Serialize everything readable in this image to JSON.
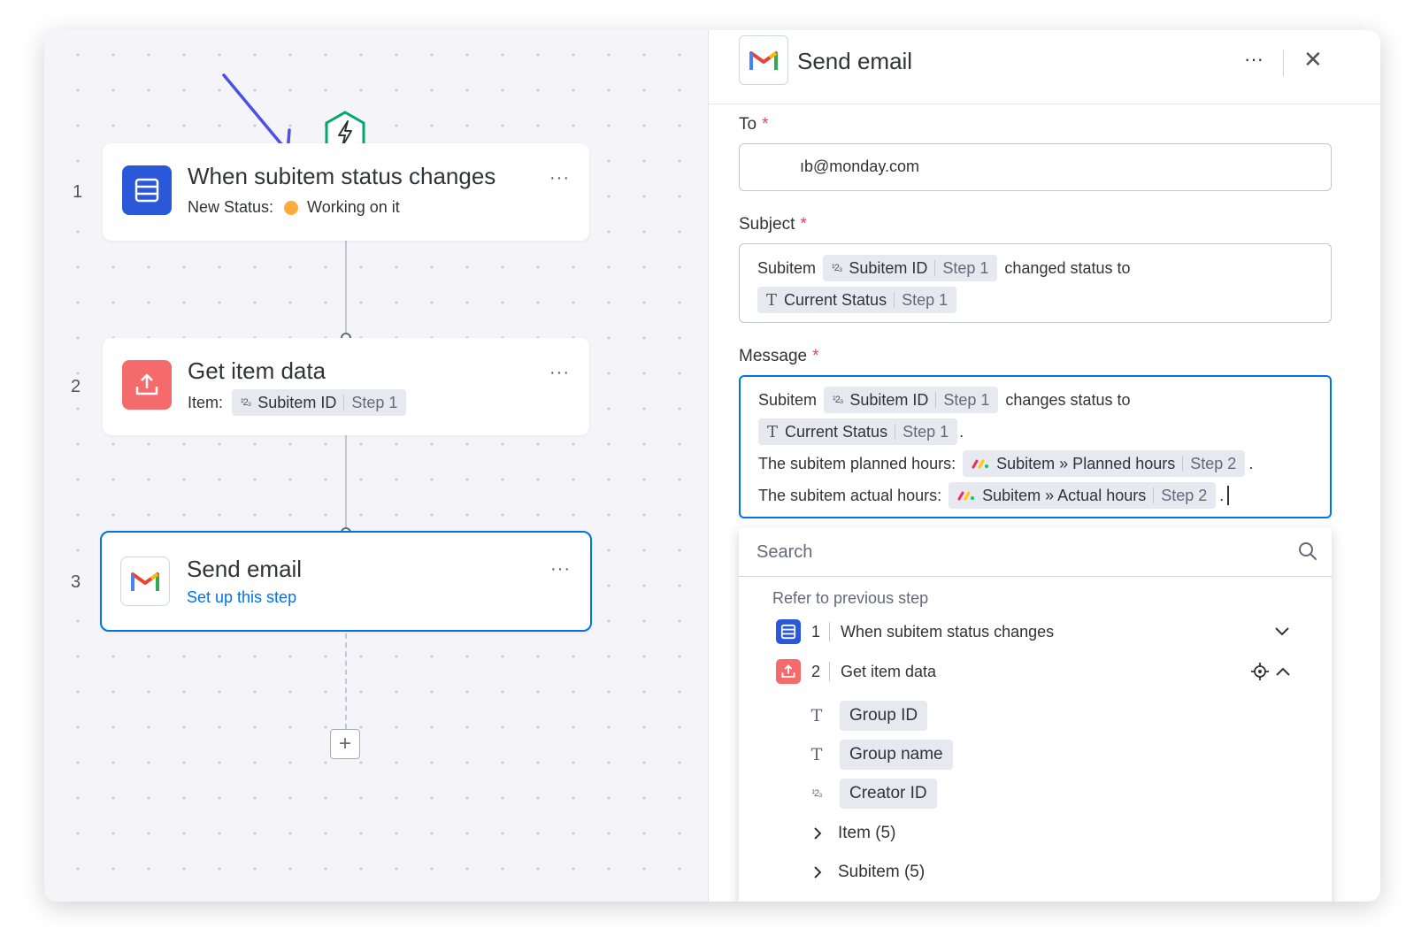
{
  "flow": {
    "steps": [
      {
        "number": "1",
        "title": "When subitem status changes",
        "sub_label": "New Status:",
        "status_value": "Working on it"
      },
      {
        "number": "2",
        "title": "Get item data",
        "sub_label": "Item:",
        "chip_label": "Subitem ID",
        "chip_step": "Step 1"
      },
      {
        "number": "3",
        "title": "Send email",
        "link": "Set up this step"
      }
    ],
    "menu_glyph": "···",
    "add_glyph": "+"
  },
  "panel": {
    "title": "Send email",
    "more_glyph": "···",
    "close_glyph": "✕",
    "to": {
      "label": "To",
      "required": "*",
      "value": "ıb@monday.com"
    },
    "subject": {
      "label": "Subject",
      "required": "*",
      "prefix": "Subitem",
      "chip1_label": "Subitem ID",
      "chip1_step": "Step 1",
      "mid": "changed status to",
      "chip2_label": "Current Status",
      "chip2_step": "Step 1"
    },
    "message": {
      "label": "Message",
      "required": "*",
      "line1_prefix": "Subitem",
      "line1_chip_label": "Subitem ID",
      "line1_chip_step": "Step 1",
      "line1_suffix": "changes status to",
      "line2_chip_label": "Current Status",
      "line2_chip_step": "Step 1",
      "line2_suffix": ".",
      "line3_prefix": "The subitem planned hours:",
      "line3_chip_label": "Subitem » Planned hours",
      "line3_chip_step": "Step 2",
      "line3_suffix": ".",
      "line4_prefix": "The subitem actual hours:",
      "line4_chip_label": "Subitem » Actual hours",
      "line4_chip_step": "Step 2",
      "line4_suffix": "."
    },
    "dropdown": {
      "search_placeholder": "Search",
      "refer_label": "Refer to previous step",
      "steps": [
        {
          "number": "1",
          "label": "When subitem status changes"
        },
        {
          "number": "2",
          "label": "Get item data"
        }
      ],
      "fields": [
        {
          "icon": "text-type-icon",
          "label": "Group ID"
        },
        {
          "icon": "text-type-icon",
          "label": "Group name"
        },
        {
          "icon": "number-type-icon",
          "label": "Creator ID"
        }
      ],
      "groups": [
        {
          "label": "Item (5)"
        },
        {
          "label": "Subitem (5)"
        }
      ]
    }
  },
  "colors": {
    "accent": "#0073ea",
    "trigger_blue": "#2b58d9",
    "action_red": "#f56b6b",
    "status_orange": "#fdab3d",
    "required_red": "#e2445c",
    "annotation_arrow": "#4b50e6",
    "trigger_hex": "#00a86b"
  },
  "icons": {
    "trigger": "list-board-icon",
    "action": "upload-icon",
    "email": "gmail-icon",
    "hex": "lightning-hexagon-icon",
    "search": "search-icon",
    "monday": "monday-logo-icon"
  }
}
